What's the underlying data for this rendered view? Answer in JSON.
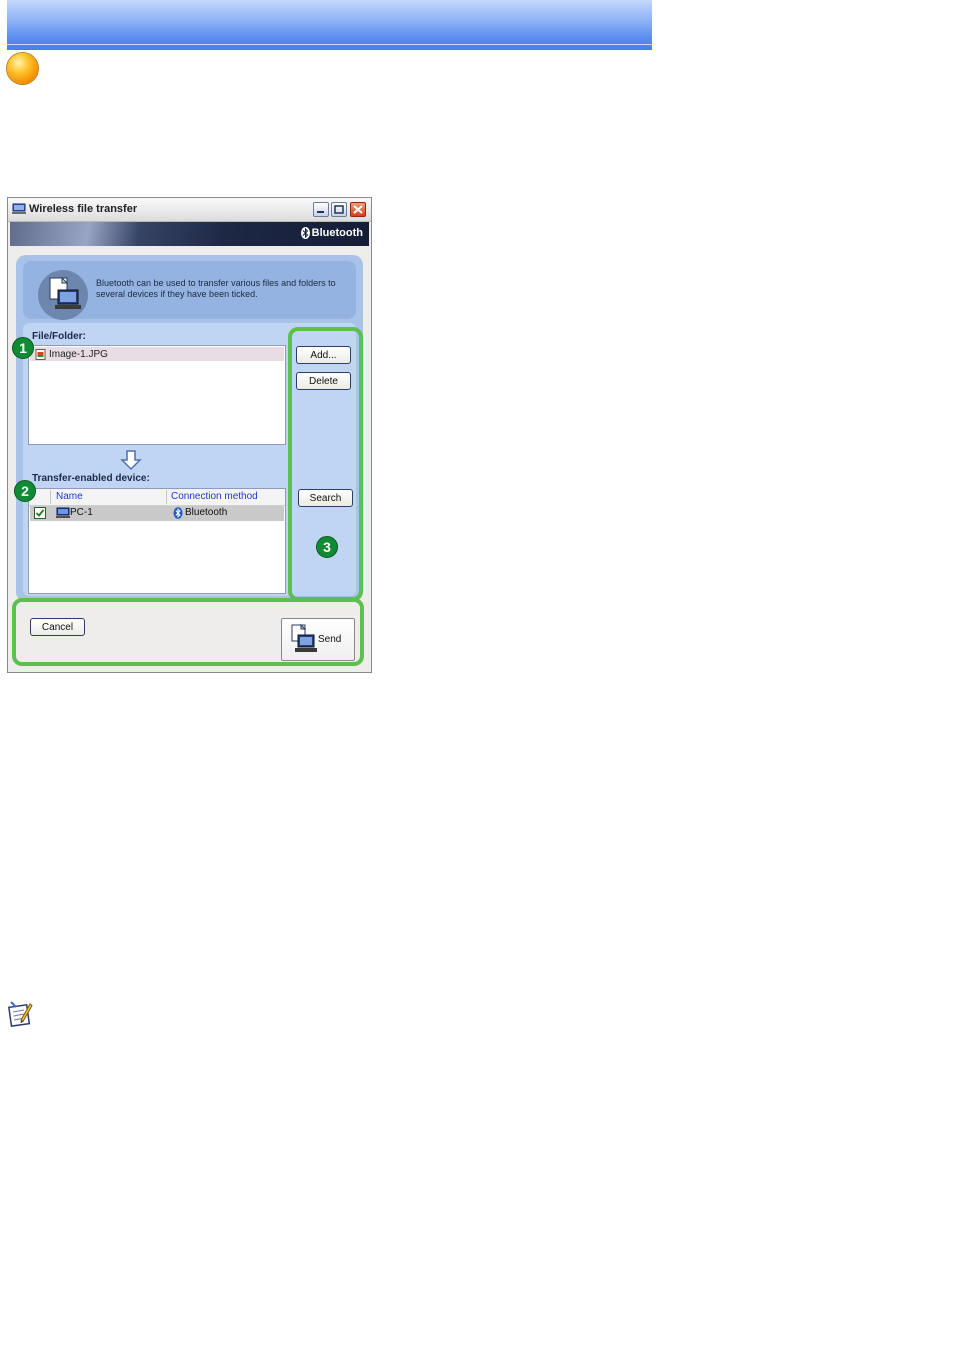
{
  "window": {
    "title": "Wireless file transfer",
    "brand": "Bluetooth"
  },
  "description": "Bluetooth can be used to transfer various files and folders to several devices if they have been ticked.",
  "file_section": {
    "label": "File/Folder:",
    "items": [
      {
        "name": "Image-1.JPG"
      }
    ]
  },
  "device_section": {
    "label": "Transfer-enabled device:",
    "columns": [
      "Name",
      "Connection method"
    ],
    "rows": [
      {
        "checked": true,
        "name": "PC-1",
        "method": "Bluetooth"
      }
    ]
  },
  "buttons": {
    "add": "Add...",
    "delete": "Delete",
    "search": "Search",
    "cancel": "Cancel",
    "send": "Send"
  },
  "callouts": [
    "1",
    "2",
    "3"
  ],
  "colors": {
    "highlight": "#5cc04f",
    "callout_badge": "#118a34",
    "header_bar": "#5c8df0"
  },
  "icons": {
    "header_orb": "orange-orb-icon",
    "note": "note-pen-icon",
    "file": "jpg-file-icon",
    "device": "pc-icon",
    "connection": "bluetooth-icon"
  }
}
